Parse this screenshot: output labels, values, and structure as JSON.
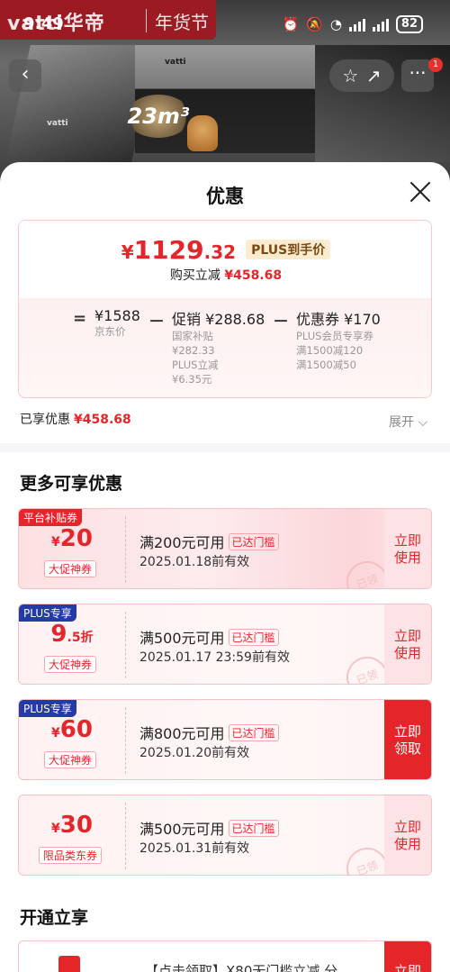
{
  "status_bar": {
    "time": "9:49",
    "battery": "82"
  },
  "background": {
    "brand_logo": "vatti华帝",
    "brand_festival": "年货节",
    "hood_brand": "vatti",
    "badge": "23m³"
  },
  "nav": {
    "back_icon": "chevron-left-icon",
    "favorite_icon": "star-icon",
    "share_icon": "share-icon",
    "more_icon": "more-icon",
    "more_badge": "1"
  },
  "sheet": {
    "title": "优惠",
    "price": {
      "yen": "¥",
      "integer": "1129",
      "decimal": ".32",
      "plus_label": "PLUS到手价",
      "buy_label": "购买立减",
      "buy_amount": "¥458.68"
    },
    "calc": {
      "eq": "=",
      "jd_price": "¥1588",
      "jd_label": "京东价",
      "minus1": "－",
      "promo": "促销 ¥288.68",
      "promo_sub1": "国家补贴",
      "promo_sub2": "¥282.33",
      "promo_sub3": "PLUS立减",
      "promo_sub4": "¥6.35元",
      "minus2": "－",
      "coupon": "优惠券 ¥170",
      "coupon_sub1": "PLUS会员专享券",
      "coupon_sub2": "满1500减120",
      "coupon_sub3": "满1500减50"
    },
    "enjoyed_label": "已享优惠",
    "enjoyed_amount": "¥458.68",
    "expand_label": "展开 ⌵",
    "more_title": "更多可享优惠",
    "coupons": [
      {
        "tag": "平台补贴券",
        "amount": "20",
        "type": "大促神券",
        "condition": "满200元可用",
        "reach": "已达门槛",
        "date": "2025.01.18前有效",
        "button": "立即\n使用",
        "stamp": "已领"
      },
      {
        "tag": "PLUS专享",
        "amount": "9",
        "amount_small": ".5折",
        "type": "大促神券",
        "condition": "满500元可用",
        "reach": "已达门槛",
        "date": "2025.01.17 23:59前有效",
        "button": "立即\n使用",
        "stamp": "已领"
      },
      {
        "tag": "PLUS专享",
        "amount": "60",
        "type": "大促神券",
        "condition": "满800元可用",
        "reach": "已达门槛",
        "date": "2025.01.20前有效",
        "button": "立即\n领取"
      },
      {
        "amount": "30",
        "type": "限品类东券",
        "condition": "满500元可用",
        "reach": "已达门槛",
        "date": "2025.01.31前有效",
        "button": "立即\n使用",
        "stamp": "已领"
      }
    ],
    "open_title": "开通立享",
    "open_card_text": "【点击领取】X80无门槛立减 分",
    "open_card_button": "立即"
  }
}
